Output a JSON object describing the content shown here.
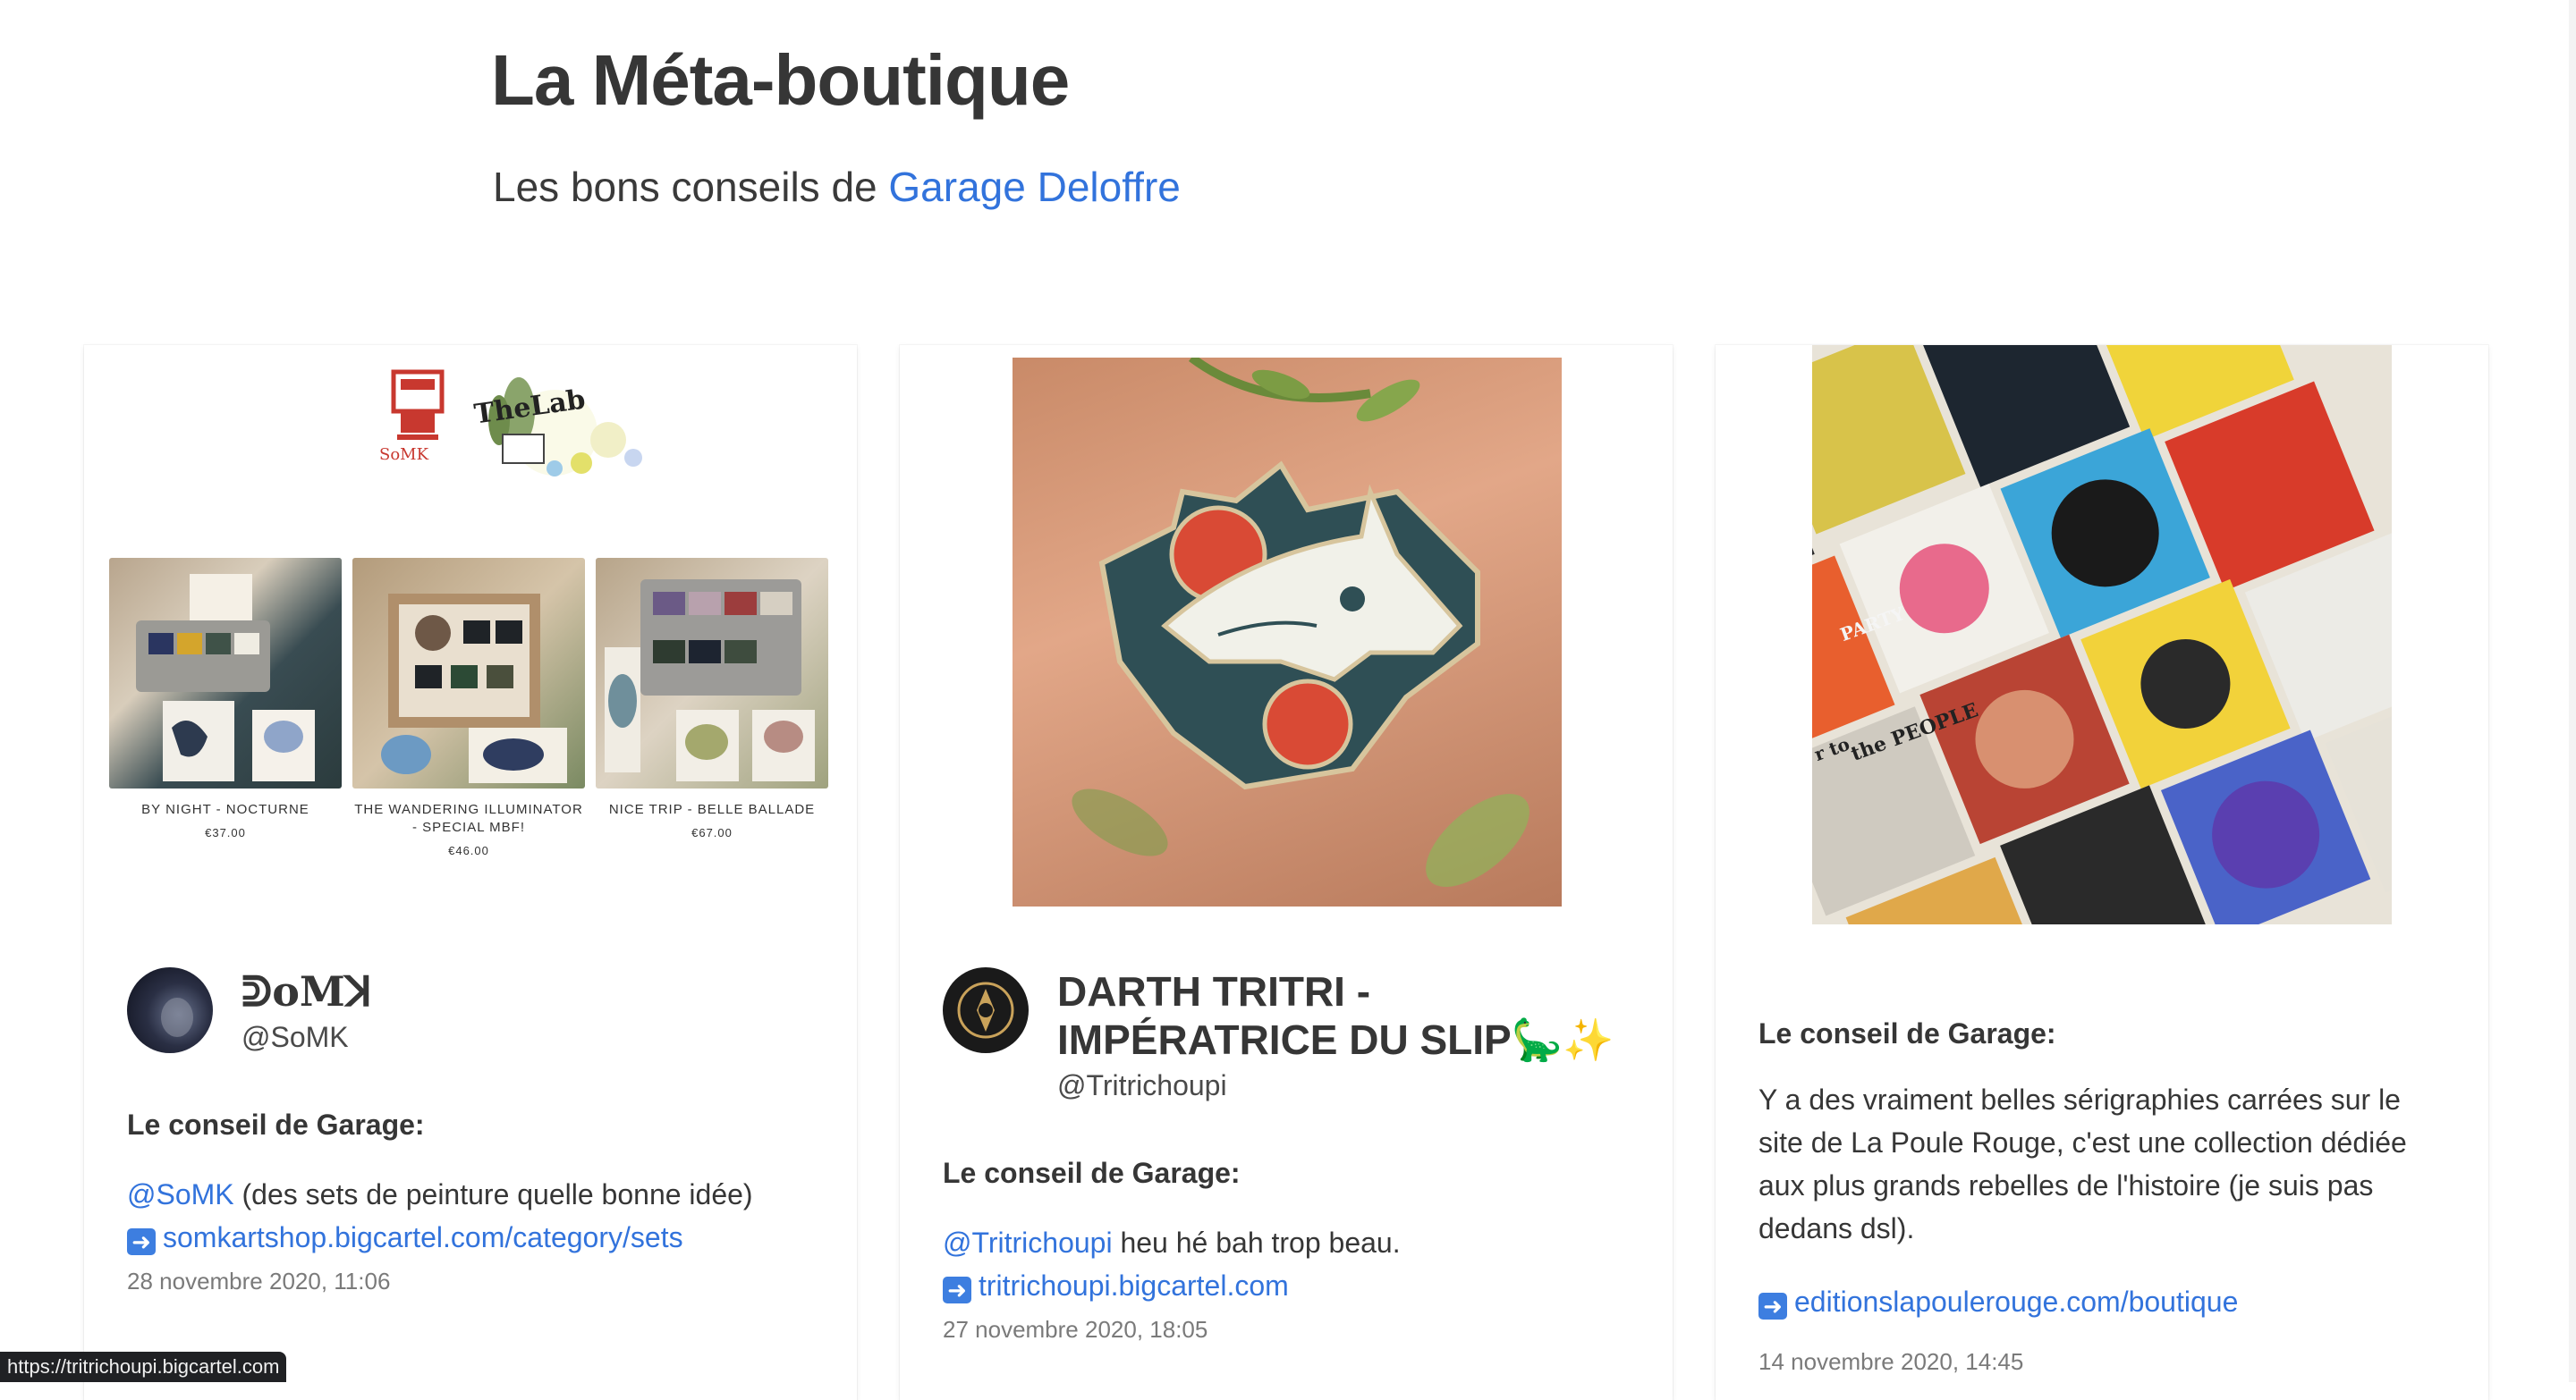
{
  "page": {
    "title": "La Méta-boutique",
    "subtitle_prefix": "Les bons conseils de",
    "subtitle_link": "Garage Deloffre"
  },
  "cards": [
    {
      "author_name": "ᕲoMꓘ",
      "author_handle": "@SoMK",
      "label": "Le conseil de Garage:",
      "mention": "@SoMK",
      "text": " (des sets de peinture quelle bonne idée)",
      "link": "somkartshop.bigcartel.com/category/sets",
      "date": "28 novembre 2020, 11:06",
      "image": {
        "logo_text": "SoMK",
        "lab_text": "TheLab",
        "products": [
          {
            "name": "BY NIGHT - NOCTURNE",
            "price": "€37.00"
          },
          {
            "name": "THE WANDERING ILLUMINATOR - SPECIAL MBF!",
            "price": "€46.00"
          },
          {
            "name": "NICE TRIP - BELLE BALLADE",
            "price": "€67.00"
          }
        ]
      }
    },
    {
      "author_name": "DARTH TRITRI - IMPÉRATRICE DU SLIP🦕✨",
      "author_handle": "@Tritrichoupi",
      "label": "Le conseil de Garage:",
      "mention": "@Tritrichoupi",
      "text": " heu hé bah trop beau.",
      "link": "tritrichoupi.bigcartel.com",
      "date": "27 novembre 2020, 18:05"
    },
    {
      "label": "Le conseil de Garage:",
      "text": "Y a des vraiment belles sérigraphies carrées sur le site de La Poule Rouge, c'est une collection dédiée aux plus grands rebelles de l'histoire (je suis pas dedans dsl).",
      "link": "editionslapoulerouge.com/boutique",
      "date": "14 novembre 2020, 14:45",
      "image": {
        "print_texts": [
          "the PEOPLE",
          "PARTY",
          "r to"
        ]
      }
    }
  ],
  "status_bar": "https://tritrichoupi.bigcartel.com",
  "colors": {
    "link": "#3273dc",
    "arrow_badge": "#3d7ee0"
  }
}
